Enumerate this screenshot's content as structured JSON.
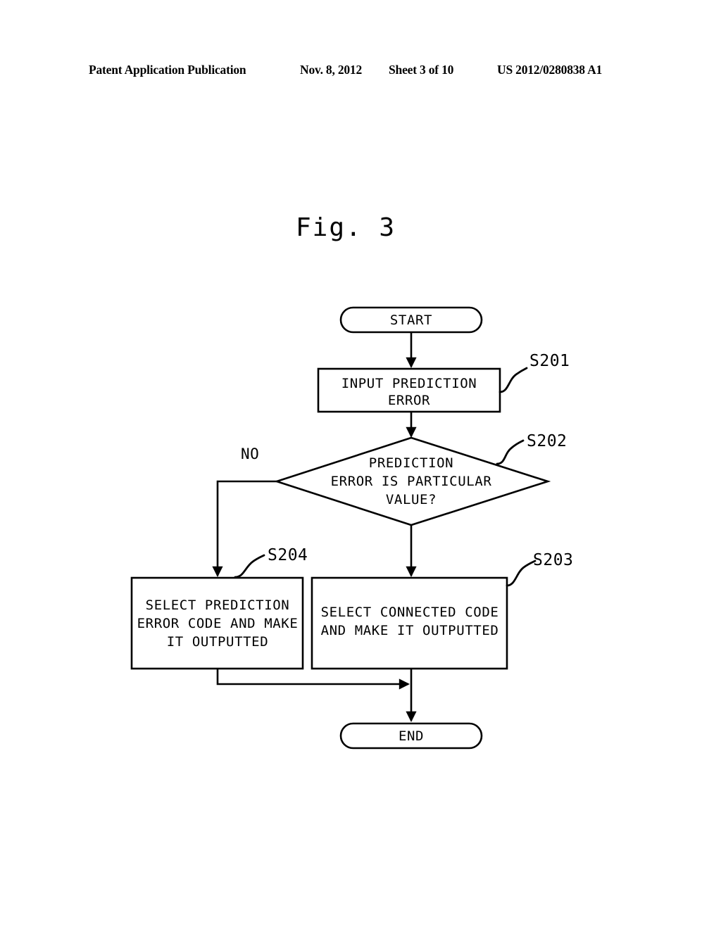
{
  "header": {
    "publication": "Patent Application Publication",
    "date": "Nov. 8, 2012",
    "sheet": "Sheet 3 of 10",
    "number": "US 2012/0280838 A1"
  },
  "figure": {
    "title": "Fig. 3",
    "type": "flowchart"
  },
  "flowchart": {
    "nodes": {
      "start": {
        "shape": "terminator",
        "label": "START"
      },
      "s201": {
        "shape": "process",
        "ref": "S201",
        "lines": [
          "INPUT PREDICTION",
          "ERROR"
        ]
      },
      "s202": {
        "shape": "decision",
        "ref": "S202",
        "lines": [
          "PREDICTION",
          "ERROR IS PARTICULAR",
          "VALUE?"
        ]
      },
      "s204": {
        "shape": "process",
        "ref": "S204",
        "lines": [
          "SELECT PREDICTION",
          "ERROR CODE AND MAKE",
          "IT OUTPUTTED"
        ]
      },
      "s203": {
        "shape": "process",
        "ref": "S203",
        "lines": [
          "SELECT CONNECTED CODE",
          "AND MAKE IT OUTPUTTED"
        ]
      },
      "end": {
        "shape": "terminator",
        "label": "END"
      }
    },
    "branches": {
      "no_label": "NO"
    },
    "edges": [
      {
        "from": "start",
        "to": "s201",
        "label": ""
      },
      {
        "from": "s201",
        "to": "s202",
        "label": ""
      },
      {
        "from": "s202",
        "to": "s204",
        "label": "NO"
      },
      {
        "from": "s202",
        "to": "s203",
        "label": ""
      },
      {
        "from": "s203",
        "to": "end",
        "label": ""
      },
      {
        "from": "s204",
        "to": "end",
        "label": ""
      }
    ]
  },
  "colors": {
    "ink": "#000000",
    "paper": "#ffffff"
  }
}
